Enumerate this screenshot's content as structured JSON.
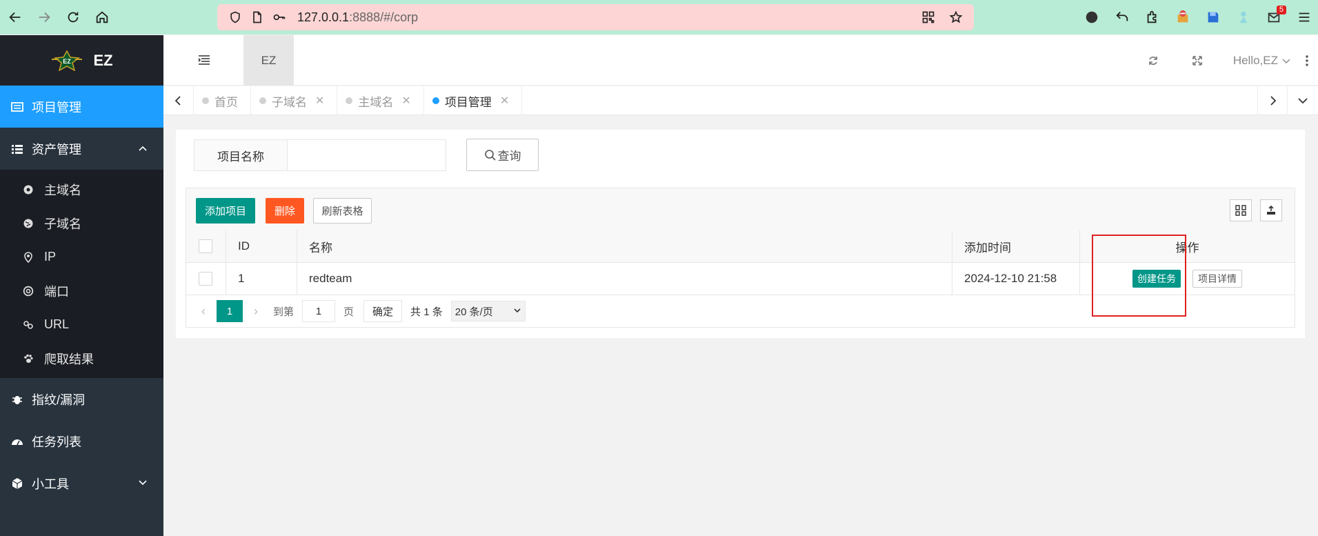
{
  "browser": {
    "url_host": "127.0.0.1",
    "url_rest": ":8888/#/corp",
    "ext_badge": "5"
  },
  "logo": {
    "text": "EZ",
    "badge": "EZ"
  },
  "sidebar": {
    "items": [
      {
        "label": "项目管理",
        "icon": "list-icon",
        "active": true
      },
      {
        "label": "资产管理",
        "icon": "table-icon",
        "expanded": true,
        "children": [
          {
            "label": "主域名",
            "icon": "settings-icon"
          },
          {
            "label": "子域名",
            "icon": "globe-icon"
          },
          {
            "label": "IP",
            "icon": "location-icon"
          },
          {
            "label": "端口",
            "icon": "lifebuoy-icon"
          },
          {
            "label": "URL",
            "icon": "link-icon"
          },
          {
            "label": "爬取结果",
            "icon": "paw-icon"
          }
        ]
      },
      {
        "label": "指纹/漏洞",
        "icon": "bug-icon"
      },
      {
        "label": "任务列表",
        "icon": "dashboard-icon"
      },
      {
        "label": "小工具",
        "icon": "cube-icon"
      }
    ]
  },
  "header": {
    "tab_label": "EZ",
    "user_label": "Hello,EZ"
  },
  "tabs": [
    {
      "label": "首页",
      "closable": false,
      "active": false
    },
    {
      "label": "子域名",
      "closable": true,
      "active": false
    },
    {
      "label": "主域名",
      "closable": true,
      "active": false
    },
    {
      "label": "项目管理",
      "closable": true,
      "active": true
    }
  ],
  "search": {
    "label": "项目名称",
    "value": "",
    "button": "查询"
  },
  "toolbar": {
    "add": "添加项目",
    "delete": "删除",
    "refresh": "刷新表格"
  },
  "table": {
    "columns": [
      "ID",
      "名称",
      "添加时间",
      "操作"
    ],
    "rows": [
      {
        "id": "1",
        "name": "redteam",
        "time": "2024-12-10 21:58",
        "actions": [
          "创建任务",
          "项目详情"
        ]
      }
    ]
  },
  "pager": {
    "current": "1",
    "goto_label": "到第",
    "goto_value": "1",
    "page_unit": "页",
    "confirm": "确定",
    "total": "共 1 条",
    "page_size": "20 条/页"
  },
  "colors": {
    "sidebar_bg": "#28333e",
    "active_blue": "#1e9fff",
    "green": "#009688",
    "orange": "#ff5722",
    "highlight": "#e02020"
  }
}
